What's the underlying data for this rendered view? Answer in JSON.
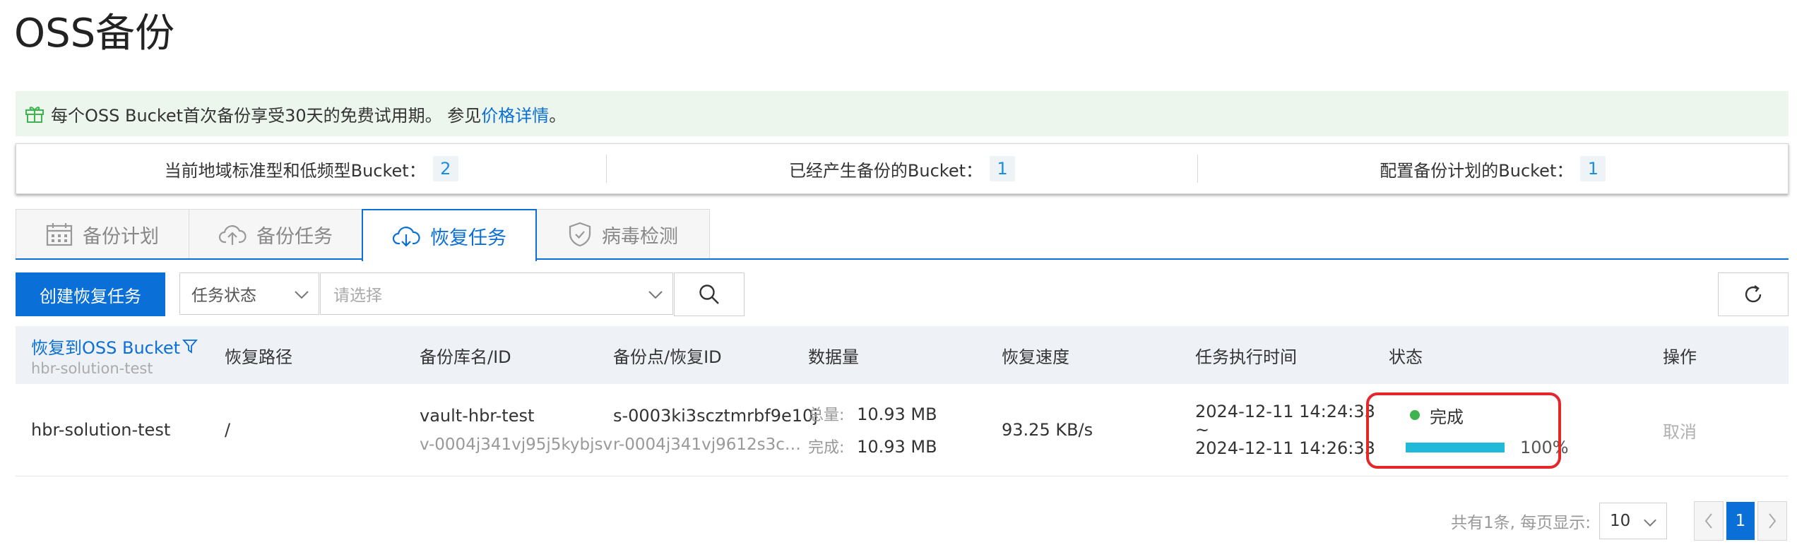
{
  "page": {
    "title": "OSS备份"
  },
  "notice": {
    "text": "每个OSS Bucket首次备份享受30天的免费试用期。 参见",
    "link": "价格详情",
    "suffix": "。"
  },
  "stats": [
    {
      "label": "当前地域标准型和低频型Bucket：",
      "value": "2"
    },
    {
      "label": "已经产生备份的Bucket：",
      "value": "1"
    },
    {
      "label": "配置备份计划的Bucket：",
      "value": "1"
    }
  ],
  "tabs": [
    {
      "label": "备份计划",
      "icon": "calendar-icon"
    },
    {
      "label": "备份任务",
      "icon": "cloud-upload-icon"
    },
    {
      "label": "恢复任务",
      "icon": "cloud-download-icon",
      "active": true
    },
    {
      "label": "病毒检测",
      "icon": "shield-check-icon"
    }
  ],
  "toolbar": {
    "create_label": "创建恢复任务",
    "status_select": "任务状态",
    "choose_placeholder": "请选择"
  },
  "table": {
    "headers": {
      "target_bucket": "恢复到OSS Bucket",
      "target_bucket_sub": "hbr-solution-test",
      "path": "恢复路径",
      "vault": "备份库名/ID",
      "snapshot": "备份点/恢复ID",
      "data": "数据量",
      "speed": "恢复速度",
      "time": "任务执行时间",
      "status": "状态",
      "action": "操作"
    },
    "row": {
      "bucket": "hbr-solution-test",
      "path": "/",
      "vault_name": "vault-hbr-test",
      "vault_id": "v-0004j341vj95j5kybjsv",
      "snapshot_id": "s-0003ki3scztmrbf9e10j",
      "restore_id": "r-0004j341vj9612s3c…",
      "total_label": "总量:",
      "total_value": "10.93 MB",
      "done_label": "完成:",
      "done_value": "10.93 MB",
      "speed": "93.25 KB/s",
      "start_time": "2024-12-11 14:24:33",
      "tilde": "~",
      "end_time": "2024-12-11 14:26:33",
      "status": "完成",
      "progress": 100,
      "progress_text": "100%",
      "action": "取消"
    }
  },
  "pager": {
    "summary": "共有1条, 每页显示:",
    "page_size": "10",
    "current": "1"
  },
  "colors": {
    "primary": "#0a6fd6",
    "success": "#3fb34f",
    "progress": "#20b9d9",
    "highlight": "#e5262b"
  }
}
